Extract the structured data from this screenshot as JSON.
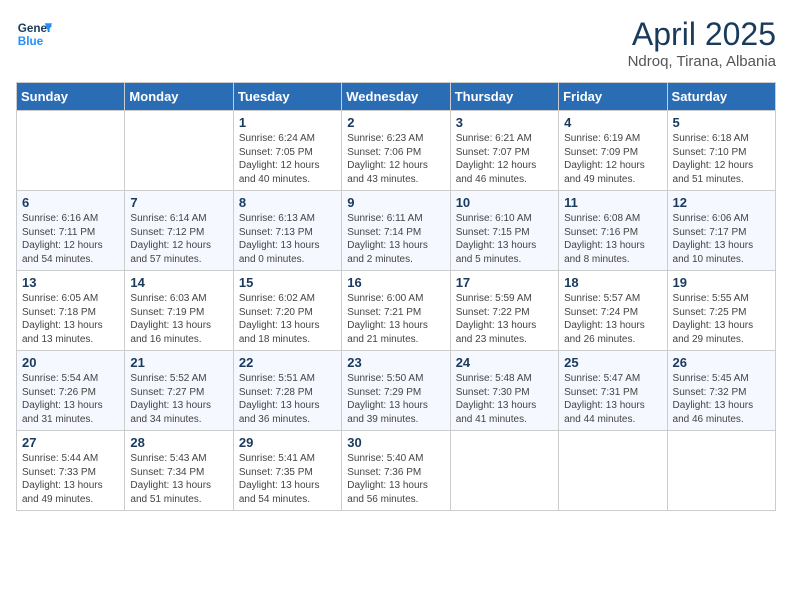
{
  "header": {
    "logo_line1": "General",
    "logo_line2": "Blue",
    "month_title": "April 2025",
    "location": "Ndroq, Tirana, Albania"
  },
  "days_of_week": [
    "Sunday",
    "Monday",
    "Tuesday",
    "Wednesday",
    "Thursday",
    "Friday",
    "Saturday"
  ],
  "weeks": [
    [
      {
        "day": "",
        "info": ""
      },
      {
        "day": "",
        "info": ""
      },
      {
        "day": "1",
        "info": "Sunrise: 6:24 AM\nSunset: 7:05 PM\nDaylight: 12 hours and 40 minutes."
      },
      {
        "day": "2",
        "info": "Sunrise: 6:23 AM\nSunset: 7:06 PM\nDaylight: 12 hours and 43 minutes."
      },
      {
        "day": "3",
        "info": "Sunrise: 6:21 AM\nSunset: 7:07 PM\nDaylight: 12 hours and 46 minutes."
      },
      {
        "day": "4",
        "info": "Sunrise: 6:19 AM\nSunset: 7:09 PM\nDaylight: 12 hours and 49 minutes."
      },
      {
        "day": "5",
        "info": "Sunrise: 6:18 AM\nSunset: 7:10 PM\nDaylight: 12 hours and 51 minutes."
      }
    ],
    [
      {
        "day": "6",
        "info": "Sunrise: 6:16 AM\nSunset: 7:11 PM\nDaylight: 12 hours and 54 minutes."
      },
      {
        "day": "7",
        "info": "Sunrise: 6:14 AM\nSunset: 7:12 PM\nDaylight: 12 hours and 57 minutes."
      },
      {
        "day": "8",
        "info": "Sunrise: 6:13 AM\nSunset: 7:13 PM\nDaylight: 13 hours and 0 minutes."
      },
      {
        "day": "9",
        "info": "Sunrise: 6:11 AM\nSunset: 7:14 PM\nDaylight: 13 hours and 2 minutes."
      },
      {
        "day": "10",
        "info": "Sunrise: 6:10 AM\nSunset: 7:15 PM\nDaylight: 13 hours and 5 minutes."
      },
      {
        "day": "11",
        "info": "Sunrise: 6:08 AM\nSunset: 7:16 PM\nDaylight: 13 hours and 8 minutes."
      },
      {
        "day": "12",
        "info": "Sunrise: 6:06 AM\nSunset: 7:17 PM\nDaylight: 13 hours and 10 minutes."
      }
    ],
    [
      {
        "day": "13",
        "info": "Sunrise: 6:05 AM\nSunset: 7:18 PM\nDaylight: 13 hours and 13 minutes."
      },
      {
        "day": "14",
        "info": "Sunrise: 6:03 AM\nSunset: 7:19 PM\nDaylight: 13 hours and 16 minutes."
      },
      {
        "day": "15",
        "info": "Sunrise: 6:02 AM\nSunset: 7:20 PM\nDaylight: 13 hours and 18 minutes."
      },
      {
        "day": "16",
        "info": "Sunrise: 6:00 AM\nSunset: 7:21 PM\nDaylight: 13 hours and 21 minutes."
      },
      {
        "day": "17",
        "info": "Sunrise: 5:59 AM\nSunset: 7:22 PM\nDaylight: 13 hours and 23 minutes."
      },
      {
        "day": "18",
        "info": "Sunrise: 5:57 AM\nSunset: 7:24 PM\nDaylight: 13 hours and 26 minutes."
      },
      {
        "day": "19",
        "info": "Sunrise: 5:55 AM\nSunset: 7:25 PM\nDaylight: 13 hours and 29 minutes."
      }
    ],
    [
      {
        "day": "20",
        "info": "Sunrise: 5:54 AM\nSunset: 7:26 PM\nDaylight: 13 hours and 31 minutes."
      },
      {
        "day": "21",
        "info": "Sunrise: 5:52 AM\nSunset: 7:27 PM\nDaylight: 13 hours and 34 minutes."
      },
      {
        "day": "22",
        "info": "Sunrise: 5:51 AM\nSunset: 7:28 PM\nDaylight: 13 hours and 36 minutes."
      },
      {
        "day": "23",
        "info": "Sunrise: 5:50 AM\nSunset: 7:29 PM\nDaylight: 13 hours and 39 minutes."
      },
      {
        "day": "24",
        "info": "Sunrise: 5:48 AM\nSunset: 7:30 PM\nDaylight: 13 hours and 41 minutes."
      },
      {
        "day": "25",
        "info": "Sunrise: 5:47 AM\nSunset: 7:31 PM\nDaylight: 13 hours and 44 minutes."
      },
      {
        "day": "26",
        "info": "Sunrise: 5:45 AM\nSunset: 7:32 PM\nDaylight: 13 hours and 46 minutes."
      }
    ],
    [
      {
        "day": "27",
        "info": "Sunrise: 5:44 AM\nSunset: 7:33 PM\nDaylight: 13 hours and 49 minutes."
      },
      {
        "day": "28",
        "info": "Sunrise: 5:43 AM\nSunset: 7:34 PM\nDaylight: 13 hours and 51 minutes."
      },
      {
        "day": "29",
        "info": "Sunrise: 5:41 AM\nSunset: 7:35 PM\nDaylight: 13 hours and 54 minutes."
      },
      {
        "day": "30",
        "info": "Sunrise: 5:40 AM\nSunset: 7:36 PM\nDaylight: 13 hours and 56 minutes."
      },
      {
        "day": "",
        "info": ""
      },
      {
        "day": "",
        "info": ""
      },
      {
        "day": "",
        "info": ""
      }
    ]
  ]
}
